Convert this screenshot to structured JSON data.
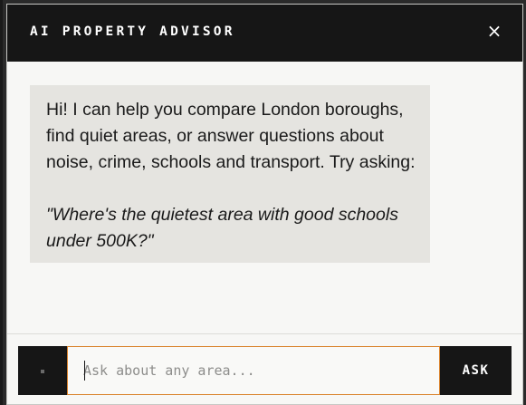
{
  "window": {
    "title": "AI PROPERTY ADVISOR",
    "close_glyph": "×"
  },
  "chat": {
    "messages": [
      {
        "role": "assistant",
        "text": "Hi! I can help you compare London boroughs, find quiet areas, or answer questions about noise, crime, schools and transport. Try asking:",
        "example": "\"Where's the quietest area with good schools under 500K?\""
      }
    ]
  },
  "composer": {
    "mic_icon": "mic-icon",
    "placeholder": "Ask about any area...",
    "value": "",
    "submit_label": "ASK"
  },
  "colors": {
    "titlebar_bg": "#161616",
    "panel_bg": "#f7f7f5",
    "bubble_bg": "#e5e4e0",
    "input_border": "#d9822b",
    "button_bg": "#161616"
  }
}
